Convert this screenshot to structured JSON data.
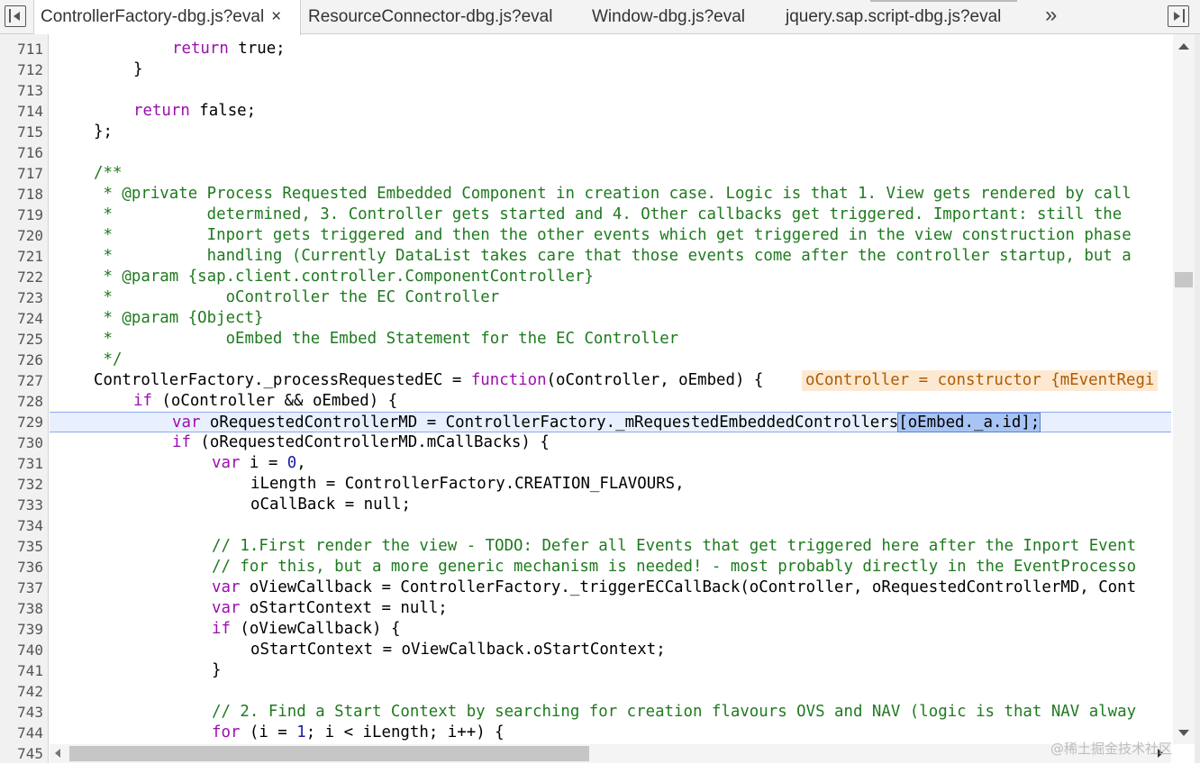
{
  "tabs": [
    {
      "label": "ControllerFactory-dbg.js?eval",
      "active": true,
      "close": "×"
    },
    {
      "label": "ResourceConnector-dbg.js?eval",
      "active": false
    },
    {
      "label": "Window-dbg.js?eval",
      "active": false
    },
    {
      "label": "jquery.sap.script-dbg.js?eval",
      "active": false
    }
  ],
  "more_tabs": "»",
  "line_numbers": [
    "711",
    "712",
    "713",
    "714",
    "715",
    "716",
    "717",
    "718",
    "719",
    "720",
    "721",
    "722",
    "723",
    "724",
    "725",
    "726",
    "727",
    "728",
    "729",
    "730",
    "731",
    "732",
    "733",
    "734",
    "735",
    "736",
    "737",
    "738",
    "739",
    "740",
    "741",
    "742",
    "743",
    "744",
    "745"
  ],
  "code": {
    "l711_kw": "return",
    "l711_rest": " true;",
    "l712": "}",
    "l714_kw": "return",
    "l714_rest": " false;",
    "l715": "};",
    "l717": "/**",
    "l718": " * @private Process Requested Embedded Component in creation case. Logic is that 1. View gets rendered by call",
    "l719": " *          determined, 3. Controller gets started and 4. Other callbacks get triggered. Important: still the",
    "l720": " *          Inport gets triggered and then the other events which get triggered in the view construction phase",
    "l721": " *          handling (Currently DataList takes care that those events come after the controller startup, but a",
    "l722": " * @param {sap.client.controller.ComponentController}",
    "l723": " *            oController the EC Controller",
    "l724": " * @param {Object}",
    "l725": " *            oEmbed the Embed Statement for the EC Controller",
    "l726": " */",
    "l727_a": "ControllerFactory._processRequestedEC = ",
    "l727_kw": "function",
    "l727_b": "(oController, oEmbed) {",
    "l727_inline": "oController = constructor {mEventRegi",
    "l728_kw": "if",
    "l728_rest": " (oController && oEmbed) {",
    "l729_kw": "var",
    "l729_a": " oRequestedControllerMD = ControllerFactory._mRequestedEmbeddedControllers",
    "l729_sel": "[oEmbed._a.id];",
    "l730_kw": "if",
    "l730_rest": " (oRequestedControllerMD.mCallBacks) {",
    "l731_kw": "var",
    "l731_a": " i = ",
    "l731_num": "0",
    "l731_b": ",",
    "l732": "iLength = ControllerFactory.CREATION_FLAVOURS,",
    "l733": "oCallBack = null;",
    "l735": "// 1.First render the view - TODO: Defer all Events that get triggered here after the Inport Event",
    "l736": "// for this, but a more generic mechanism is needed! - most probably directly in the EventProcesso",
    "l737_kw": "var",
    "l737_rest": " oViewCallback = ControllerFactory._triggerECCallBack(oController, oRequestedControllerMD, Cont",
    "l738_kw": "var",
    "l738_rest": " oStartContext = null;",
    "l739_kw": "if",
    "l739_rest": " (oViewCallback) {",
    "l740": "oStartContext = oViewCallback.oStartContext;",
    "l741": "}",
    "l743": "// 2. Find a Start Context by searching for creation flavours OVS and NAV (logic is that NAV alway",
    "l744_kw": "for",
    "l744_a": " (i = ",
    "l744_num": "1",
    "l744_b": "; i < iLength; i++) {"
  },
  "watermark": "@稀土掘金技术社区"
}
